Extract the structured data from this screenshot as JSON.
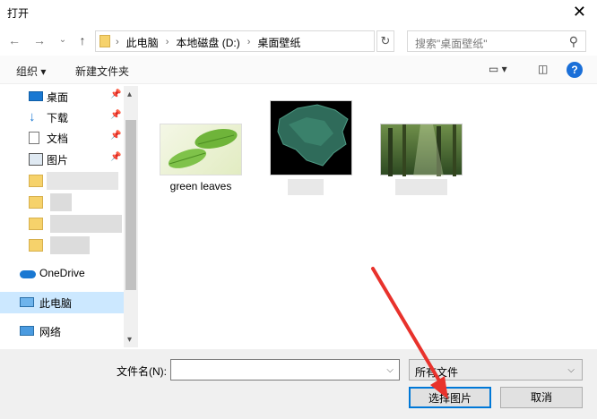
{
  "window": {
    "title": "打开",
    "close": "✕"
  },
  "nav": {
    "back": "←",
    "forward": "→",
    "recent": "⌄",
    "up": "↑",
    "breadcrumbs": [
      "此电脑",
      "本地磁盘 (D:)",
      "桌面壁纸"
    ],
    "crumb_sep": "›",
    "search_placeholder": "搜索\"桌面壁纸\""
  },
  "toolbar": {
    "organize": "组织 ▾",
    "new_folder": "新建文件夹"
  },
  "sidebar": {
    "items": [
      {
        "label": "桌面",
        "icon": "desktop-icon",
        "pinned": true
      },
      {
        "label": "下载",
        "icon": "download-icon",
        "pinned": true
      },
      {
        "label": "文档",
        "icon": "document-icon",
        "pinned": true
      },
      {
        "label": "图片",
        "icon": "picture-icon",
        "pinned": true
      },
      {
        "label": "OneDrive",
        "icon": "onedrive-icon",
        "pinned": false
      },
      {
        "label": "此电脑",
        "icon": "computer-icon",
        "pinned": false,
        "selected": true
      },
      {
        "label": "网络",
        "icon": "network-icon",
        "pinned": false
      }
    ]
  },
  "files": [
    {
      "name": "green leaves",
      "icon": "leaves-thumbnail"
    },
    {
      "name": "",
      "icon": "map-thumbnail"
    },
    {
      "name": "",
      "icon": "forest-thumbnail"
    }
  ],
  "bottom": {
    "filename_label": "文件名(N):",
    "filename_value": "",
    "filetype": "所有文件",
    "open_button": "选择图片",
    "cancel_button": "取消"
  },
  "colors": {
    "accent": "#0078d7",
    "selected_bg": "#cce8ff",
    "arrow": "#e8322c"
  }
}
